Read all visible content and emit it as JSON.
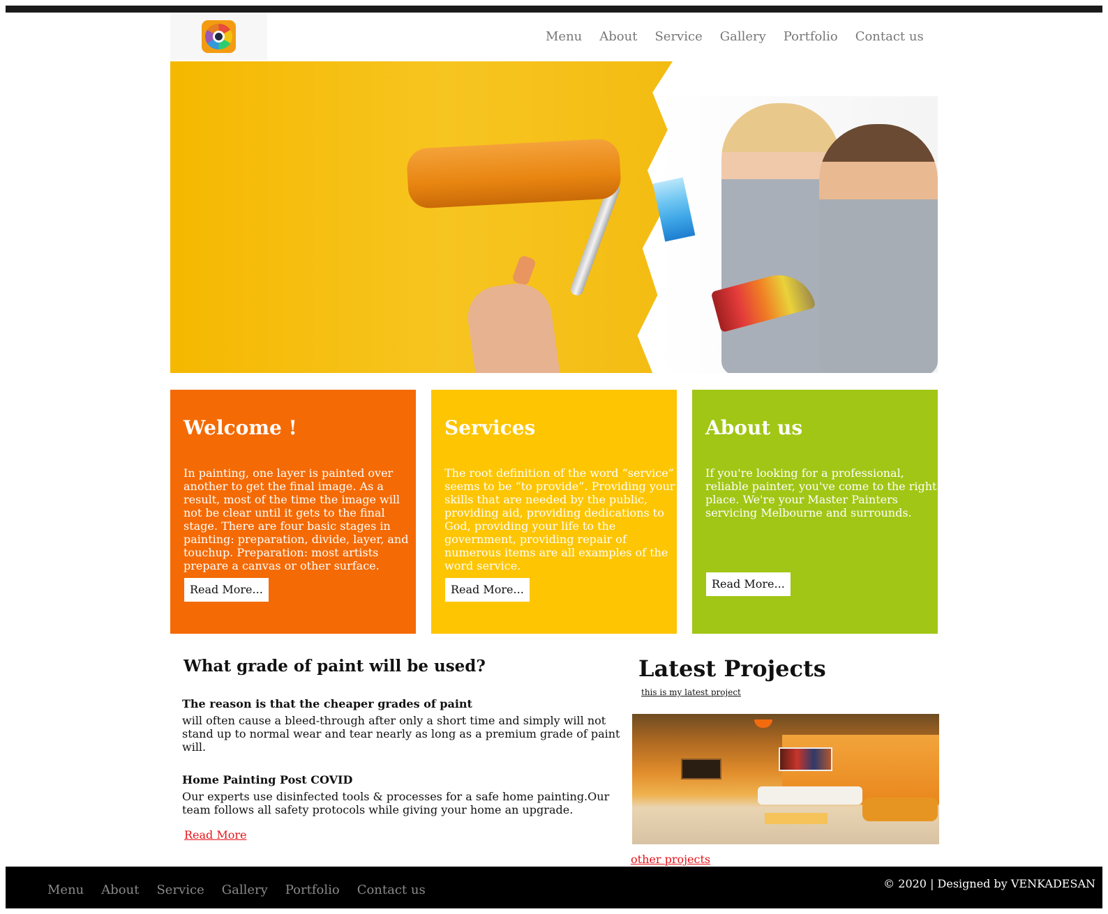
{
  "nav": {
    "items": [
      "Menu",
      "About",
      "Service",
      "Gallery",
      "Portfolio",
      "Contact us"
    ]
  },
  "panels": [
    {
      "title": "Welcome !",
      "text": "In painting, one layer is painted over another to get the final image. As a result, most of the time the image will not be clear until it gets to the final stage. There are four basic stages in painting: preparation, divide, layer, and touchup. Preparation: most artists prepare a canvas or other surface.",
      "button": "Read More...",
      "color": "#f46a05"
    },
    {
      "title": "Services",
      "text": "The root definition of the word “service” seems to be “to provide”. Providing your skills that are needed by the public, providing aid, providing dedications to God, providing your life to the government, providing repair of numerous items are all examples of the word service.",
      "button": "Read More...",
      "color": "#fdc502"
    },
    {
      "title": "About us",
      "text": "If you're looking for a professional, reliable painter, you've come to the right place. We're your Master Painters servicing Melbourne and surrounds.",
      "button": "Read More...",
      "color": "#a1c615"
    }
  ],
  "article": {
    "title": "What grade of paint will be used?",
    "subtitle": "The reason is that the cheaper grades of paint",
    "text": "will often cause a bleed-through after only a short time and simply will not stand up to normal wear and tear nearly as long as a premium grade of paint will.",
    "covid_title": "Home Painting Post COVID",
    "covid_text": "Our experts use disinfected tools & processes for a safe home painting.Our team follows all safety protocols while giving your home an upgrade.",
    "read_more": "Read More"
  },
  "projects": {
    "title": "Latest Projects",
    "subtitle": "this is my latest project",
    "other_link": "other projects"
  },
  "footer": {
    "items": [
      "Menu",
      "About",
      "Service",
      "Gallery",
      "Portfolio",
      "Contact us"
    ],
    "copyright": "© 2020 | Designed by VENKADESAN"
  },
  "colors": {
    "link": "#e8141b",
    "nav_text": "#777777",
    "footer_bg": "#000000"
  }
}
